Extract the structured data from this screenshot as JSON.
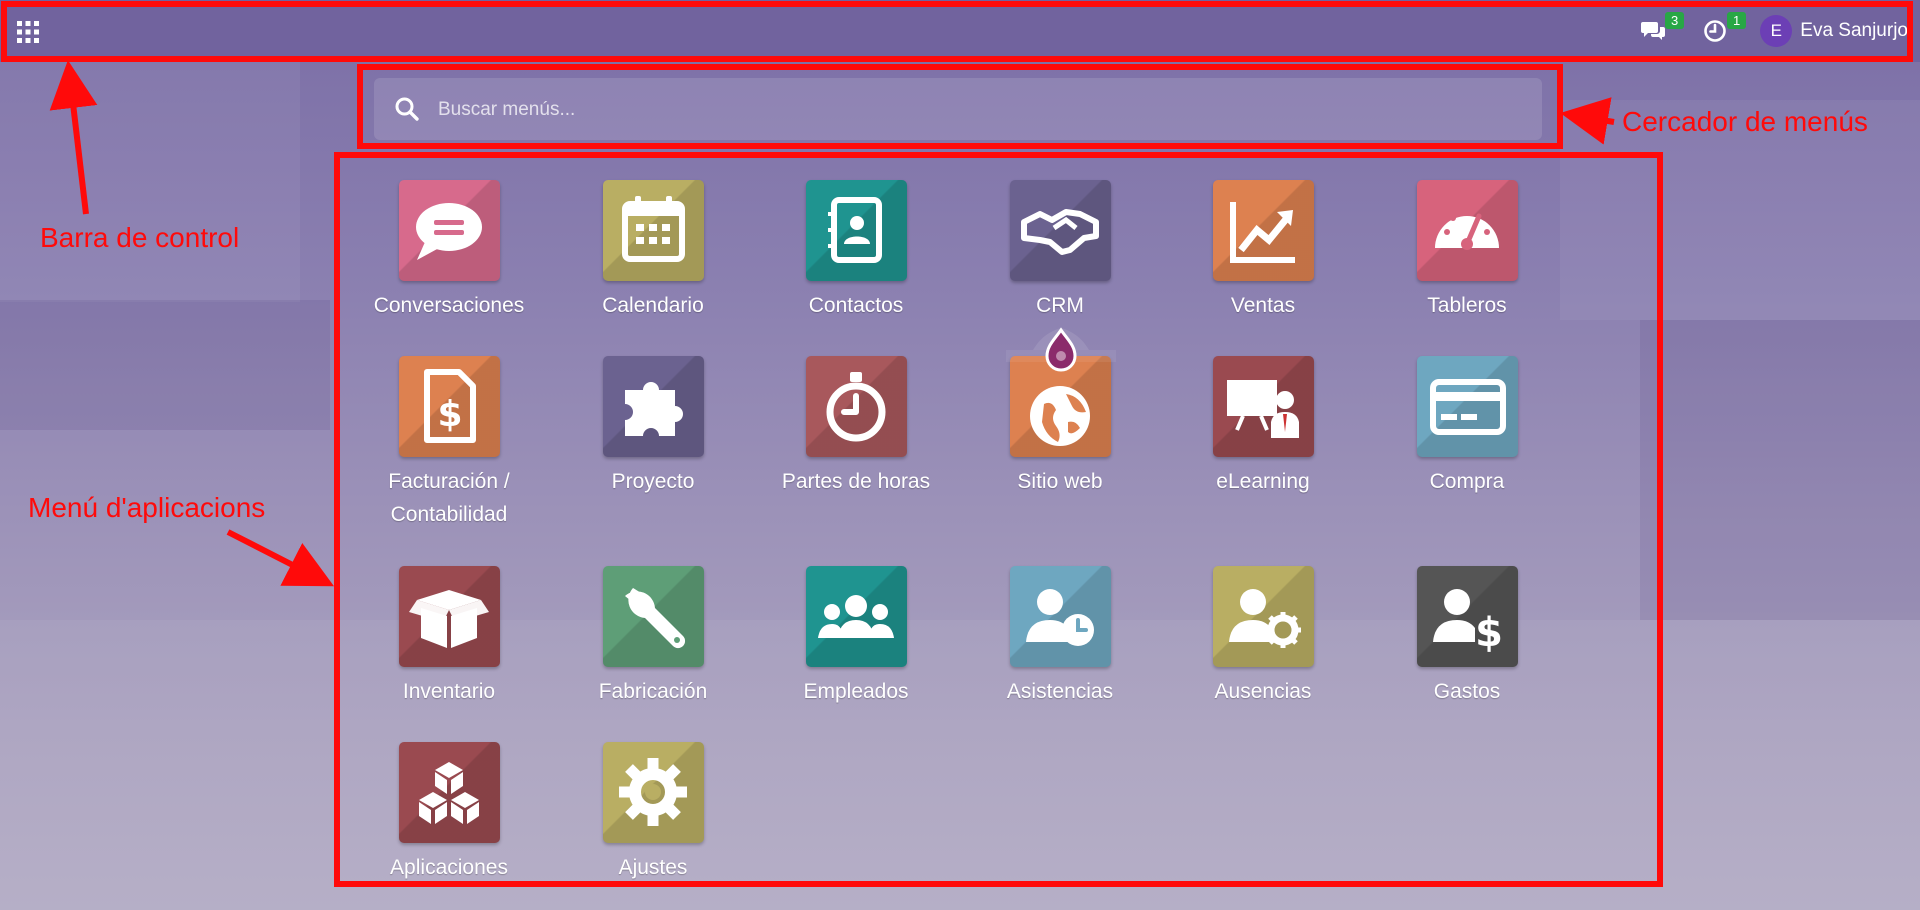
{
  "navbar": {
    "messages_badge": "3",
    "activities_badge": "1",
    "user_initial": "E",
    "user_name": "Eva Sanjurjo"
  },
  "search": {
    "placeholder": "Buscar menús..."
  },
  "annotations": {
    "control_bar": "Barra de control",
    "menu_search": "Cercador de menús",
    "app_menu": "Menú d'aplicacions"
  },
  "apps": [
    {
      "label": "Conversaciones",
      "icon": "chat-icon",
      "color": "#d76a8c"
    },
    {
      "label": "Calendario",
      "icon": "calendar-icon",
      "color": "#b9ae63"
    },
    {
      "label": "Contactos",
      "icon": "address-book-icon",
      "color": "#1f9490"
    },
    {
      "label": "CRM",
      "icon": "handshake-icon",
      "color": "#6b6290"
    },
    {
      "label": "Ventas",
      "icon": "chart-line-icon",
      "color": "#dd8150"
    },
    {
      "label": "Tableros",
      "icon": "dashboard-gauge-icon",
      "color": "#d7637c"
    },
    {
      "label": "Facturación / Contabilidad",
      "icon": "invoice-dollar-icon",
      "color": "#dd8150"
    },
    {
      "label": "Proyecto",
      "icon": "puzzle-icon",
      "color": "#6b6290"
    },
    {
      "label": "Partes de horas",
      "icon": "stopwatch-icon",
      "color": "#a8585c"
    },
    {
      "label": "Sitio web",
      "icon": "globe-icon",
      "color": "#dd8150"
    },
    {
      "label": "eLearning",
      "icon": "presentation-icon",
      "color": "#9a4a50"
    },
    {
      "label": "Compra",
      "icon": "credit-card-icon",
      "color": "#6ea7c0"
    },
    {
      "label": "Inventario",
      "icon": "box-icon",
      "color": "#9a4a50"
    },
    {
      "label": "Fabricación",
      "icon": "wrench-icon",
      "color": "#5e9e77"
    },
    {
      "label": "Empleados",
      "icon": "users-icon",
      "color": "#1f9490"
    },
    {
      "label": "Asistencias",
      "icon": "user-clock-icon",
      "color": "#6ea7c0"
    },
    {
      "label": "Ausencias",
      "icon": "user-gear-icon",
      "color": "#b9ae63"
    },
    {
      "label": "Gastos",
      "icon": "user-dollar-icon",
      "color": "#555555"
    },
    {
      "label": "Aplicaciones",
      "icon": "cubes-icon",
      "color": "#9a4a50"
    },
    {
      "label": "Ajustes",
      "icon": "gear-icon",
      "color": "#b9ae63"
    }
  ]
}
